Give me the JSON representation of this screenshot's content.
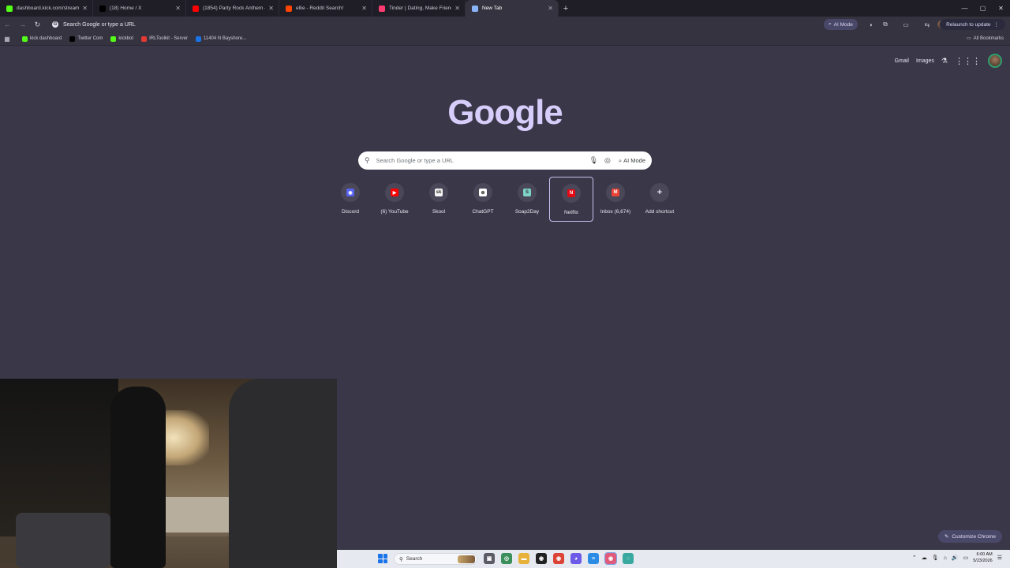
{
  "tabs": [
    {
      "title": "dashboard.kick.com/stream",
      "favicon": "kick-icon",
      "color": "#53fc18",
      "active": false
    },
    {
      "title": "(18) Home / X",
      "favicon": "x-icon",
      "color": "#000000",
      "active": false
    },
    {
      "title": "(1854) Party Rock Anthem - Yo",
      "favicon": "youtube-icon",
      "color": "#ff0000",
      "active": false
    },
    {
      "title": "ellie - Reddit Search!",
      "favicon": "reddit-icon",
      "color": "#ff4500",
      "active": false
    },
    {
      "title": "Tinder | Dating, Make Friends &",
      "favicon": "tinder-icon",
      "color": "#fe3c72",
      "active": false
    },
    {
      "title": "New Tab",
      "favicon": "chrome-icon",
      "color": "#8ab4f8",
      "active": true
    }
  ],
  "toolbar": {
    "omnibox_text": "Search Google or type a URL",
    "ai_mode_label": "AI Mode",
    "relaunch_label": "Relaunch to update"
  },
  "bookmarks": [
    {
      "label": "kick dashboard",
      "icon": "kick-icon",
      "color": "#53fc18"
    },
    {
      "label": "Twitter Com",
      "icon": "x-icon",
      "color": "#000000"
    },
    {
      "label": "kickbot",
      "icon": "kickbot-icon",
      "color": "#53fc18"
    },
    {
      "label": "IRLToolkit - Server",
      "icon": "irltoolkit-icon",
      "color": "#e53935"
    },
    {
      "label": "11404 N Bayshore...",
      "icon": "maps-icon",
      "color": "#1a73e8"
    }
  ],
  "all_bookmarks_label": "All Bookmarks",
  "ntp": {
    "gmail_label": "Gmail",
    "images_label": "Images",
    "logo_text": "Google",
    "search_placeholder": "Search Google or type a URL",
    "ai_mode_label": "AI Mode",
    "customize_label": "Customize Chrome"
  },
  "shortcuts": [
    {
      "label": "Discord",
      "icon": "discord-icon",
      "color": "#5865f2",
      "glyph": "◉"
    },
    {
      "label": "(6) YouTube",
      "icon": "youtube-icon",
      "color": "#ff0000",
      "glyph": "▶"
    },
    {
      "label": "Skool",
      "icon": "skool-icon",
      "color": "#f5f5f5",
      "glyph": "sk"
    },
    {
      "label": "ChatGPT",
      "icon": "chatgpt-icon",
      "color": "#ffffff",
      "glyph": "⊛"
    },
    {
      "label": "Soap2Day",
      "icon": "soap2day-icon",
      "color": "#7fd3c8",
      "glyph": "S"
    },
    {
      "label": "Netflix",
      "icon": "netflix-icon",
      "color": "#e50914",
      "glyph": "N"
    },
    {
      "label": "Inbox (6,674)",
      "icon": "gmail-icon",
      "color": "#ea4335",
      "glyph": "M"
    },
    {
      "label": "Add shortcut",
      "icon": "plus-icon",
      "color": "#e8e6f0",
      "glyph": "+"
    }
  ],
  "selected_shortcut": "Netflix",
  "taskbar": {
    "search_label": "Search",
    "time": "6:00 AM",
    "date": "5/23/2026"
  }
}
